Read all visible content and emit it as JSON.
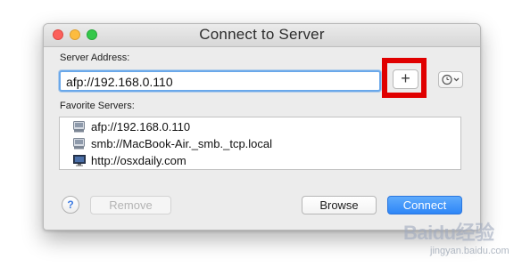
{
  "window": {
    "title": "Connect to Server"
  },
  "address": {
    "label": "Server Address:",
    "value": "afp://192.168.0.110",
    "add_button_label": "+"
  },
  "favorites": {
    "label": "Favorite Servers:",
    "items": [
      {
        "text": "afp://192.168.0.110",
        "icon": "network-drive-icon"
      },
      {
        "text": "smb://MacBook-Air._smb._tcp.local",
        "icon": "network-drive-icon"
      },
      {
        "text": "http://osxdaily.com",
        "icon": "computer-display-icon"
      }
    ]
  },
  "buttons": {
    "help": "?",
    "remove": "Remove",
    "browse": "Browse",
    "connect": "Connect"
  },
  "watermark": {
    "logo": "Baidu经验",
    "sub": "jingyan.baidu.com"
  },
  "colors": {
    "highlight_box": "#e00000",
    "focus_ring": "#6aa8ea",
    "connect_button": "#2e86f7"
  }
}
